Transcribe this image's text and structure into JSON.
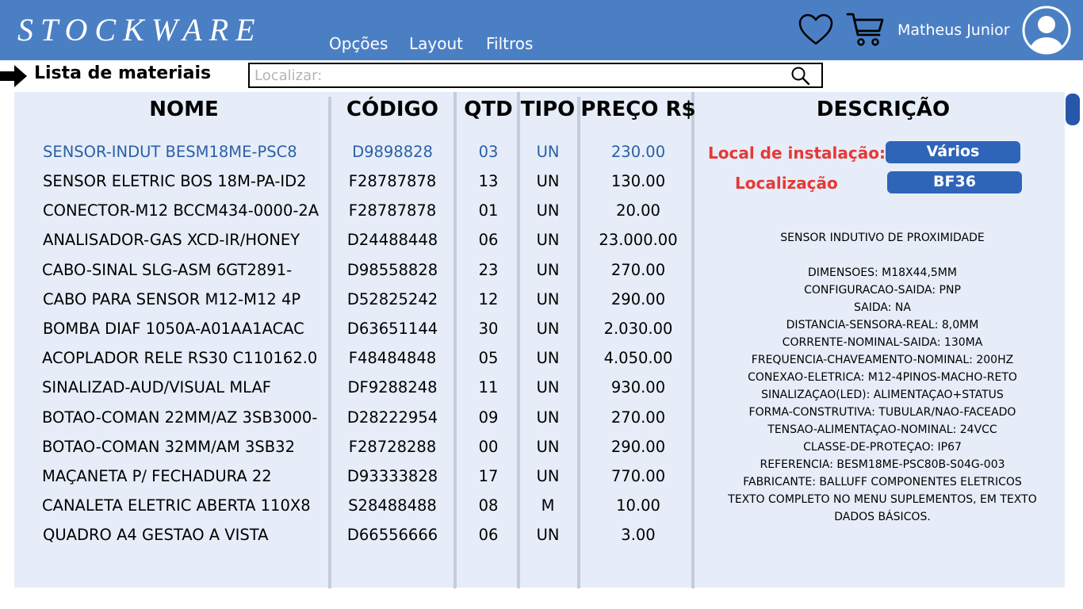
{
  "header": {
    "app_title": "STOCKWARE",
    "menu": [
      {
        "label": "Opções"
      },
      {
        "label": "Layout"
      },
      {
        "label": "Filtros"
      }
    ],
    "icons": {
      "favorites": "heart-icon",
      "cart": "cart-icon",
      "avatar": "user-avatar-icon"
    },
    "user_name": "Matheus Junior"
  },
  "toolbar": {
    "arrow_icon": "arrow-right-icon",
    "page_title": "Lista de materiais",
    "search": {
      "placeholder": "Localizar:",
      "value": "",
      "icon": "search-icon"
    }
  },
  "table": {
    "columns": [
      "NOME",
      "CÓDIGO",
      "QTD",
      "TIPO",
      "PREÇO R$"
    ],
    "selected_index": 0,
    "rows": [
      {
        "name": "SENSOR-INDUT BESM18ME-PSC8",
        "code": "D9898828",
        "qtd": "03",
        "tipo": "UN",
        "price": "230.00"
      },
      {
        "name": "SENSOR ELETRIC BOS 18M-PA-ID2",
        "code": "F28787878",
        "qtd": "13",
        "tipo": "UN",
        "price": "130.00"
      },
      {
        "name": "CONECTOR-M12 BCCM434-0000-2A",
        "code": "F28787878",
        "qtd": "01",
        "tipo": "UN",
        "price": "20.00"
      },
      {
        "name": "ANALISADOR-GAS XCD-IR/HONEY",
        "code": "D24488448",
        "qtd": "06",
        "tipo": "UN",
        "price": "23.000.00"
      },
      {
        "name": "CABO-SINAL SLG-ASM 6GT2891-",
        "code": "D98558828",
        "qtd": "23",
        "tipo": "UN",
        "price": "270.00"
      },
      {
        "name": "CABO PARA SENSOR M12-M12 4P",
        "code": "D52825242",
        "qtd": "12",
        "tipo": "UN",
        "price": "290.00"
      },
      {
        "name": "BOMBA DIAF 1050A-A01AA1ACAC",
        "code": "D63651144",
        "qtd": "30",
        "tipo": "UN",
        "price": "2.030.00"
      },
      {
        "name": "ACOPLADOR RELE RS30 C110162.0",
        "code": "F48484848",
        "qtd": "05",
        "tipo": "UN",
        "price": "4.050.00"
      },
      {
        "name": "SINALIZAD-AUD/VISUAL MLAF",
        "code": "DF9288248",
        "qtd": "11",
        "tipo": "UN",
        "price": "930.00"
      },
      {
        "name": "BOTAO-COMAN 22MM/AZ 3SB3000-",
        "code": "D28222954",
        "qtd": "09",
        "tipo": "UN",
        "price": "270.00"
      },
      {
        "name": "BOTAO-COMAN 32MM/AM 3SB32",
        "code": "F28728288",
        "qtd": "00",
        "tipo": "UN",
        "price": "290.00"
      },
      {
        "name": "MAÇANETA P/ FECHADURA 22",
        "code": "D93333828",
        "qtd": "17",
        "tipo": "UN",
        "price": "770.00"
      },
      {
        "name": "CANALETA ELETRIC ABERTA 110X8",
        "code": "S28488488",
        "qtd": "08",
        "tipo": "M",
        "price": "10.00"
      },
      {
        "name": "QUADRO A4 GESTAO A VISTA",
        "code": "D66556666",
        "qtd": "06",
        "tipo": "UN",
        "price": "3.00"
      }
    ]
  },
  "details": {
    "header": "DESCRIÇÃO",
    "install_label": "Local de instalação:",
    "install_value": "Vários",
    "location_label": "Localização",
    "location_value": "BF36",
    "description_lines": [
      "SENSOR INDUTIVO DE PROXIMIDADE",
      "",
      "DIMENSOES: M18X44,5MM",
      "CONFIGURACAO-SAIDA: PNP",
      "SAIDA: NA",
      "DISTANCIA-SENSORA-REAL: 8,0MM",
      "CORRENTE-NOMINAL-SAIDA: 130MA",
      "FREQUENCIA-CHAVEAMENTO-NOMINAL: 200HZ",
      "CONEXAO-ELETRICA: M12-4PINOS-MACHO-RETO",
      "SINALIZAÇAO(LED): ALIMENTAÇAO+STATUS",
      "FORMA-CONSTRUTIVA: TUBULAR/NAO-FACEADO",
      "TENSAO-ALIMENTAÇAO-NOMINAL: 24VCC",
      "CLASSE-DE-PROTEÇAO: IP67",
      "REFERENCIA: BESM18ME-PSC80B-S04G-003",
      "FABRICANTE: BALLUFF COMPONENTES ELETRICOS",
      "TEXTO COMPLETO NO MENU SUPLEMENTOS, EM TEXTO",
      "DADOS BÁSICOS."
    ]
  },
  "colors": {
    "topbar": "#4b7fc4",
    "panel": "#e6edf8",
    "selected_text": "#2b5fa8",
    "label_red": "#e53935",
    "badge": "#2f65b8",
    "scrollbar": "#2757a8"
  }
}
